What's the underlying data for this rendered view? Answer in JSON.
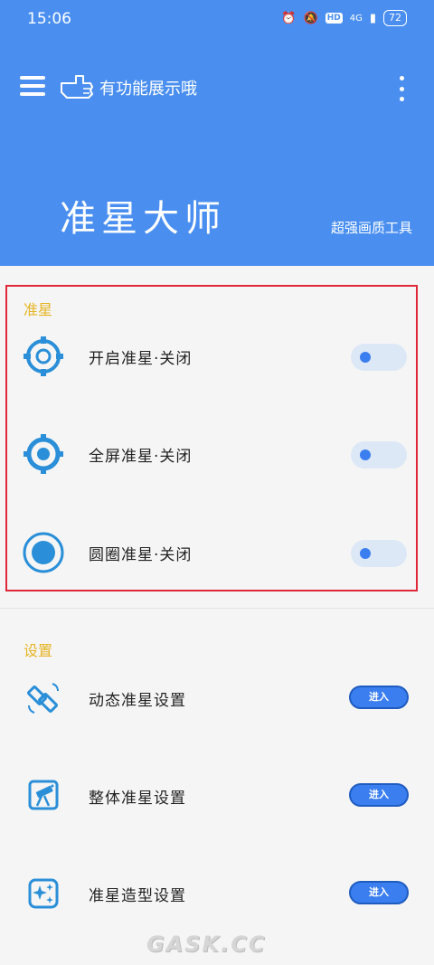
{
  "status": {
    "time": "15:06",
    "hd": "HD",
    "signal": "4G",
    "battery": "72"
  },
  "appbar": {
    "title": "有功能展示哦",
    "hero_title": "准星大师",
    "hero_subtitle": "超强画质工具"
  },
  "crosshair": {
    "title": "准星",
    "items": [
      {
        "label": "开启准星·关闭",
        "icon": "target-ring-icon"
      },
      {
        "label": "全屏准星·关闭",
        "icon": "target-dot-icon"
      },
      {
        "label": "圆圈准星·关闭",
        "icon": "circle-dot-icon"
      }
    ]
  },
  "settings": {
    "title": "设置",
    "enter_label": "进入",
    "items": [
      {
        "label": "动态准星设置",
        "icon": "satellite-icon"
      },
      {
        "label": "整体准星设置",
        "icon": "telescope-icon"
      },
      {
        "label": "准星造型设置",
        "icon": "sparkle-icon"
      }
    ]
  },
  "colors": {
    "primary": "#4a8ff0",
    "accent_gold": "#e6b422",
    "icon_blue": "#2a8fd8",
    "highlight_border": "#e02838"
  },
  "watermark": "GASK.CC"
}
